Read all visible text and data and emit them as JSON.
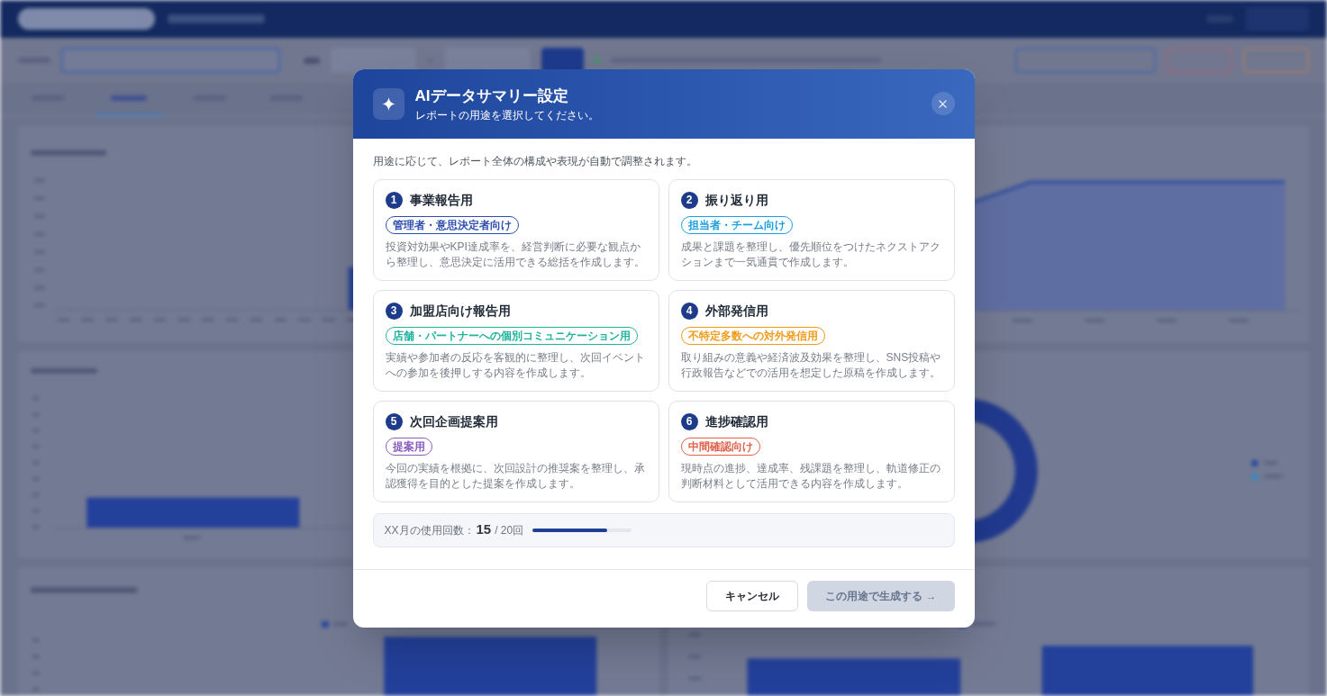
{
  "background_tabs": [
    {
      "selected": false
    },
    {
      "selected": true
    },
    {
      "selected": false
    },
    {
      "selected": false
    }
  ],
  "dialog": {
    "title": "AIデータサマリー設定",
    "subtitle": "レポートの用途を選択してください。",
    "description": "用途に応じて、レポート全体の構成や表現が自動で調整されます。",
    "purposes": [
      {
        "number": "1",
        "title": "事業報告用",
        "tag": "管理者・意思決定者向け",
        "color": "#2f4fb0",
        "description": "投資対効果やKPI達成率を、経営判断に必要な観点から整理し、意思決定に活用できる総括を作成します。",
        "selected": false
      },
      {
        "number": "2",
        "title": "振り返り用",
        "tag": "担当者・チーム向け",
        "color": "#1a9fe0",
        "description": "成果と課題を整理し、優先順位をつけたネクストアクションまで一気通貫で作成します。",
        "selected": false
      },
      {
        "number": "3",
        "title": "加盟店向け報告用",
        "tag": "店舗・パートナーへの個別コミュニケーション用",
        "color": "#1db39c",
        "description": "実績や参加者の反応を客観的に整理し、次回イベントへの参加を後押しする内容を作成します。",
        "selected": false
      },
      {
        "number": "4",
        "title": "外部発信用",
        "tag": "不特定多数への対外発信用",
        "color": "#f09a1a",
        "description": "取り組みの意義や経済波及効果を整理し、SNS投稿や行政報告などでの活用を想定した原稿を作成します。",
        "selected": false
      },
      {
        "number": "5",
        "title": "次回企画提案用",
        "tag": "提案用",
        "color": "#8a5cc0",
        "description": "今回の実績を根拠に、次回設計の推奨案を整理し、承認獲得を目的とした提案を作成します。",
        "selected": false
      },
      {
        "number": "6",
        "title": "進捗確認用",
        "tag": "中間確認向け",
        "color": "#e0604a",
        "description": "現時点の進捗、達成率、残課題を整理し、軌道修正の判断材料として活用できる内容を作成します。",
        "selected": false
      }
    ],
    "usage": {
      "label": "XX月の使用回数：",
      "count": "15",
      "limit": "/ 20回",
      "level": 0.75
    },
    "buttons": [
      {
        "label": "キャンセル",
        "kind": "secondary",
        "disabled": false
      },
      {
        "label": "この用途で生成する →",
        "kind": "primary",
        "disabled": true
      }
    ]
  }
}
